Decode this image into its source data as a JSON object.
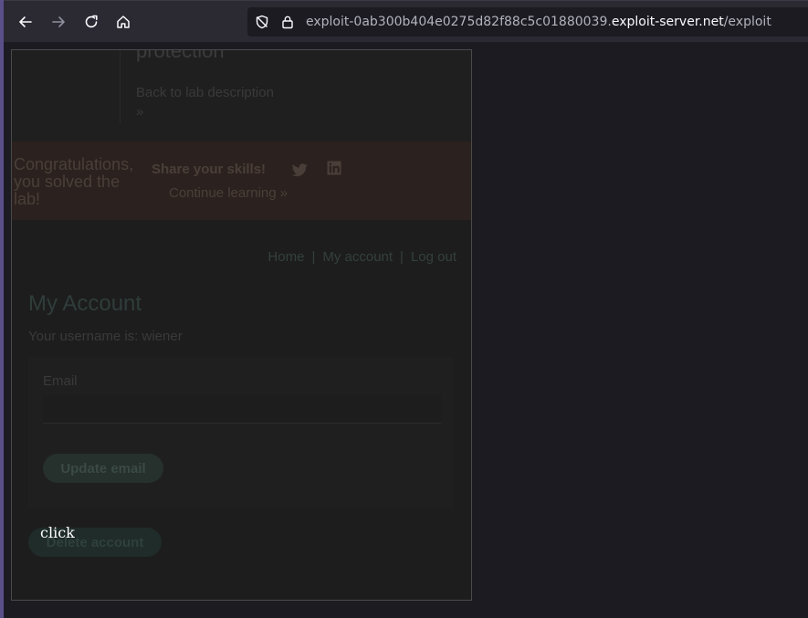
{
  "browser": {
    "url_prefix": "exploit-0ab300b404e0275d82f88c5c01880039.",
    "url_host": "exploit-server.net",
    "url_path": "/exploit"
  },
  "lab": {
    "title_partial": "protection",
    "back_link": "Back to lab description",
    "back_chevrons": "»"
  },
  "banner": {
    "congrats": "Congratulations, you solved the lab!",
    "share": "Share your skills!",
    "continue": "Continue learning",
    "continue_chevrons": "»"
  },
  "nav": {
    "home": "Home",
    "separator": "|",
    "my_account": "My account",
    "log_out": "Log out"
  },
  "account": {
    "title": "My Account",
    "username_text": "Your username is: wiener",
    "email_label": "Email",
    "email_value": "",
    "update_button": "Update email",
    "delete_button": "Delete account"
  },
  "decoy": {
    "label": "click"
  }
}
